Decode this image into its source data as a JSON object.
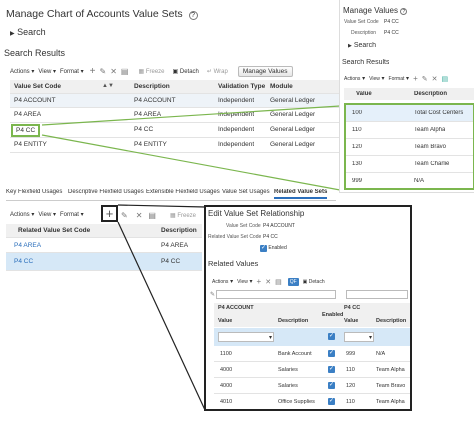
{
  "main": {
    "title": "Manage Chart of Accounts Value Sets",
    "search_label": "Search",
    "results_label": "Search Results",
    "toolbar": {
      "actions": "Actions",
      "view": "View",
      "format": "Format",
      "freeze": "Freeze",
      "detach": "Detach",
      "wrap": "Wrap",
      "manage_values": "Manage Values"
    },
    "columns": [
      "Value Set Code",
      "Description",
      "Validation Type",
      "Module"
    ],
    "rows": [
      {
        "code": "P4 ACCOUNT",
        "desc": "P4 ACCOUNT",
        "validation": "Independent",
        "module": "General Ledger"
      },
      {
        "code": "P4 AREA",
        "desc": "P4 AREA",
        "validation": "Independent",
        "module": "General Ledger"
      },
      {
        "code": "P4 CC",
        "desc": "P4 CC",
        "validation": "Independent",
        "module": "General Ledger"
      },
      {
        "code": "P4 ENTITY",
        "desc": "P4 ENTITY",
        "validation": "Independent",
        "module": "General Ledger"
      }
    ],
    "tabs": [
      "Key Flexfield Usages",
      "Descriptive Flexfield Usages",
      "Extensible Flexfield Usages",
      "Value Set Usages",
      "Related Value Sets"
    ],
    "lower_toolbar": {
      "actions": "Actions",
      "view": "View",
      "format": "Format",
      "freeze": "Freeze"
    },
    "lower_columns": [
      "Related Value Set Code",
      "Description"
    ],
    "lower_rows": [
      {
        "code": "P4 AREA",
        "desc": "P4 AREA"
      },
      {
        "code": "P4 CC",
        "desc": "P4 CC"
      }
    ]
  },
  "manage_values": {
    "title": "Manage Values",
    "value_set_code_label": "Value Set Code",
    "value_set_code": "P4 CC",
    "description_label": "Description",
    "description": "P4 CC",
    "search_label": "Search",
    "results_label": "Search Results",
    "toolbar": {
      "actions": "Actions",
      "view": "View",
      "format": "Format"
    },
    "columns": [
      "Value",
      "Description"
    ],
    "rows": [
      {
        "value": "100",
        "desc": "Total Cost Centers"
      },
      {
        "value": "110",
        "desc": "Team Alpha"
      },
      {
        "value": "120",
        "desc": "Team Bravo"
      },
      {
        "value": "130",
        "desc": "Team Charlie"
      },
      {
        "value": "999",
        "desc": "N/A"
      }
    ]
  },
  "edit_relationship": {
    "title": "Edit Value Set Relationship",
    "value_set_code_label": "Value Set Code",
    "value_set_code": "P4 ACCOUNT",
    "related_code_label": "Related Value Set Code",
    "related_code": "P4 CC",
    "enabled_label": "Enabled",
    "related_values_label": "Related Values",
    "toolbar": {
      "actions": "Actions",
      "view": "View",
      "detach": "Detach"
    },
    "group_left": "P4 ACCOUNT",
    "group_right": "P4 CC",
    "columns": {
      "value": "Value",
      "description": "Description",
      "enabled": "Enabled",
      "value2": "Value",
      "description2": "Description"
    },
    "rows": [
      {
        "v1": "1100",
        "d1": "Bank Account",
        "v2": "999",
        "d2": "N/A"
      },
      {
        "v1": "4000",
        "d1": "Salaries",
        "v2": "110",
        "d2": "Team Alpha"
      },
      {
        "v1": "4000",
        "d1": "Salaries",
        "v2": "120",
        "d2": "Team Bravo"
      },
      {
        "v1": "4010",
        "d1": "Office Supplies",
        "v2": "110",
        "d2": "Team Alpha"
      }
    ]
  },
  "colors": {
    "accent_green": "#7bb64e",
    "link_blue": "#2a6ebb",
    "selected_row": "#d6e8f7",
    "header_gray": "#f0f0f0"
  }
}
